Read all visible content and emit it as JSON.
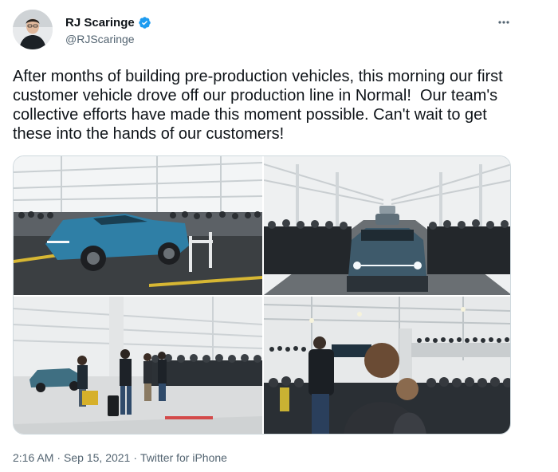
{
  "author": {
    "display_name": "RJ Scaringe",
    "handle": "@RJScaringe",
    "verified": true,
    "verified_icon": "verified-badge-icon",
    "verified_color": "#1d9bf0"
  },
  "more_menu": {
    "icon": "more-horizontal-icon"
  },
  "tweet": {
    "text": "After months of building pre-production vehicles, this morning our first customer vehicle drove off our production line in Normal!  Our team's collective efforts have made this moment possible. Can't wait to get these into the hands of our customers!"
  },
  "media": {
    "photos": [
      {
        "id": "photo-1",
        "accent_color": "#2f7fa6"
      },
      {
        "id": "photo-2",
        "accent_color": "#3e5a6b"
      },
      {
        "id": "photo-3",
        "accent_color": "#3f6f82"
      },
      {
        "id": "photo-4",
        "accent_color": "#222a33"
      }
    ]
  },
  "meta": {
    "time": "2:16 AM",
    "separator": "·",
    "date": "Sep 15, 2021",
    "source": "Twitter for iPhone"
  },
  "colors": {
    "text_primary": "#0f1419",
    "text_secondary": "#536471",
    "border": "#cfd9de"
  }
}
